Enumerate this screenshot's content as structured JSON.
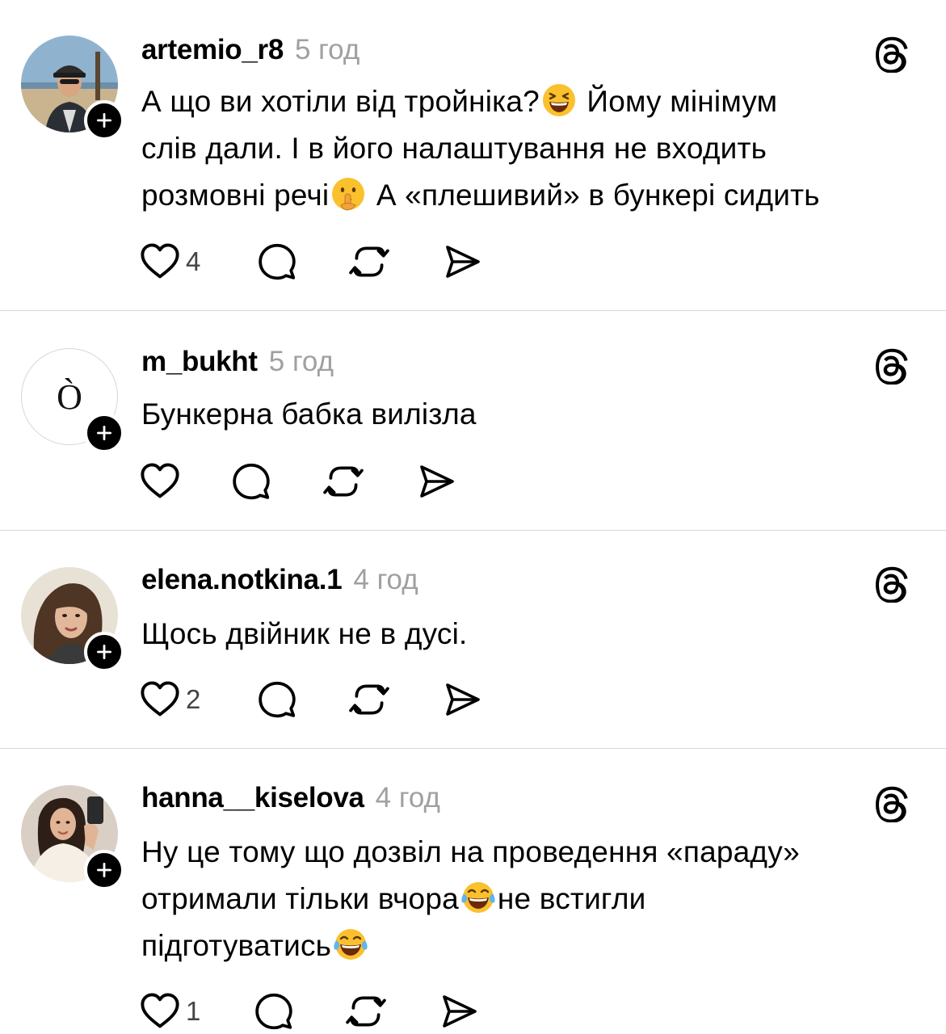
{
  "comments": [
    {
      "username": "artemio_r8",
      "time": "5 год",
      "text_parts": [
        "А що ви хотіли від тройніка?",
        "Йому мінімум",
        "слів дали. І в його налаштування не входить",
        "розмовні речі",
        "А «плешивий» в бункері сидить"
      ],
      "likes": "4",
      "avatar": "photo-man-cap-beach",
      "emojis": [
        "laughing-face-emoji",
        "shushing-face-emoji"
      ]
    },
    {
      "username": "m_bukht",
      "time": "5 год",
      "text_parts": [
        "Бункерна бабка вилізла"
      ],
      "likes": "",
      "avatar_letter": "Ò"
    },
    {
      "username": "elena.notkina.1",
      "time": "4 год",
      "text_parts": [
        "Щось двійник не в дусі."
      ],
      "likes": "2",
      "avatar": "photo-woman-portrait"
    },
    {
      "username": "hanna__kiselova",
      "time": "4 год",
      "text_parts": [
        "Ну це тому що дозвіл на проведення «параду»",
        "отримали тільки вчора",
        "не встигли",
        "підготуватись"
      ],
      "likes": "1",
      "avatar": "photo-woman-mirror-selfie",
      "emojis": [
        "tears-of-joy-emoji",
        "tears-of-joy-emoji"
      ]
    }
  ],
  "icons": {
    "follow": "plus-icon",
    "app": "threads-logo-icon",
    "like": "heart-icon",
    "reply": "comment-bubble-icon",
    "repost": "repost-icon",
    "share": "share-send-icon"
  },
  "colors": {
    "text": "#000000",
    "time": "#a0a0a0",
    "divider": "#d8d8d8",
    "emoji_yellow": "#fbc02d"
  }
}
